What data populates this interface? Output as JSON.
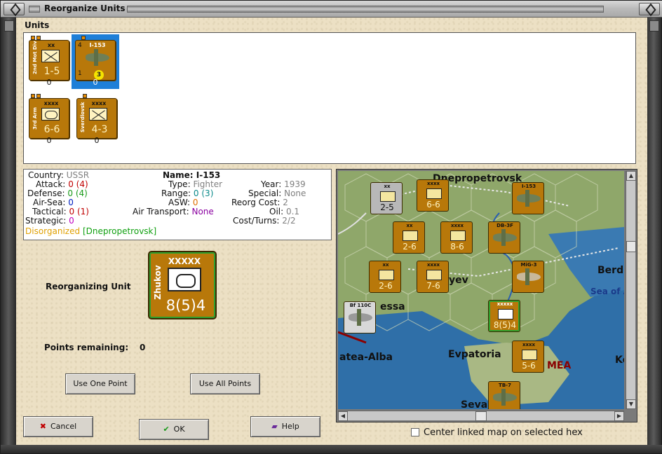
{
  "window": {
    "title": "Reorganize Units"
  },
  "units_section": {
    "label": "Units",
    "slots": [
      {
        "name": "2nd Mot Div",
        "echelon": "xx",
        "strength": "1-5",
        "value": "0",
        "selected": false
      },
      {
        "name": "I-153",
        "echelon": "I-153",
        "strength": "3",
        "level": "4",
        "badge_left": "1",
        "value": "0",
        "selected": true
      },
      {
        "name": "3rd Arm",
        "echelon": "xxxx",
        "strength": "6-6",
        "value": "0",
        "selected": false
      },
      {
        "name": "Sverdlovsk",
        "echelon": "xxxx",
        "strength": "4-3",
        "value": "0",
        "selected": false
      }
    ]
  },
  "info": {
    "country_label": "Country:",
    "country": "USSR",
    "attack_label": "Attack:",
    "attack_a": "0",
    "attack_b": "(4)",
    "defense_label": "Defense:",
    "defense_a": "0",
    "defense_b": "(4)",
    "airsea_label": "Air-Sea:",
    "airsea": "0",
    "tactical_label": "Tactical:",
    "tactical_a": "0",
    "tactical_b": "(1)",
    "strategic_label": "Strategic:",
    "strategic": "0",
    "status": "Disorganized",
    "location": "[Dnepropetrovsk]",
    "name_label": "Name:",
    "name": "I-153",
    "type_label": "Type:",
    "type": "Fighter",
    "range_label": "Range:",
    "range_a": "0",
    "range_b": "(3)",
    "asw_label": "ASW:",
    "asw": "0",
    "airtransport_label": "Air Transport:",
    "airtransport": "None",
    "year_label": "Year:",
    "year": "1939",
    "special_label": "Special:",
    "special": "None",
    "reorgcost_label": "Reorg Cost:",
    "reorgcost": "2",
    "oil_label": "Oil:",
    "oil": "0.1",
    "costturns_label": "Cost/Turns:",
    "costturns": "2/2"
  },
  "reorganizing": {
    "label": "Reorganizing Unit",
    "unit_name": "Zhukov",
    "echelon": "XXXXX",
    "strength": "8(5)4"
  },
  "points": {
    "label": "Points remaining:",
    "value": "0"
  },
  "buttons": {
    "use_one": "Use One Point",
    "use_all": "Use All Points",
    "cancel": "Cancel",
    "ok": "OK",
    "help": "Help"
  },
  "map": {
    "labels": [
      "Dnepropetrovsk",
      "yev",
      "Berdi",
      "Sea of A",
      "essa",
      "Evpatoria",
      "atea-Alba",
      "MEA",
      "Ko",
      "Seva"
    ],
    "counters": [
      {
        "echelon": "xx",
        "strength": "2-5"
      },
      {
        "echelon": "xxxx",
        "strength": "6-6"
      },
      {
        "echelon": "xx",
        "strength": "2-6"
      },
      {
        "echelon": "xxxx",
        "strength": "8-6"
      },
      {
        "echelon": "xx",
        "strength": "2-6"
      },
      {
        "echelon": "xxxx",
        "strength": "7-6"
      },
      {
        "echelon": "xxxxx",
        "strength": "8(5)4"
      },
      {
        "echelon": "xxxx",
        "strength": "5-6"
      }
    ],
    "air_units": [
      "I-153",
      "DB-3F",
      "MiG-3",
      "Bf 110C",
      "TB-7"
    ],
    "center_linked_label": "Center linked map on selected hex"
  },
  "colors": {
    "panel_bg": "#ece0c4",
    "counter_ussr": "#b8780a",
    "selected": "#1e7fd8"
  }
}
